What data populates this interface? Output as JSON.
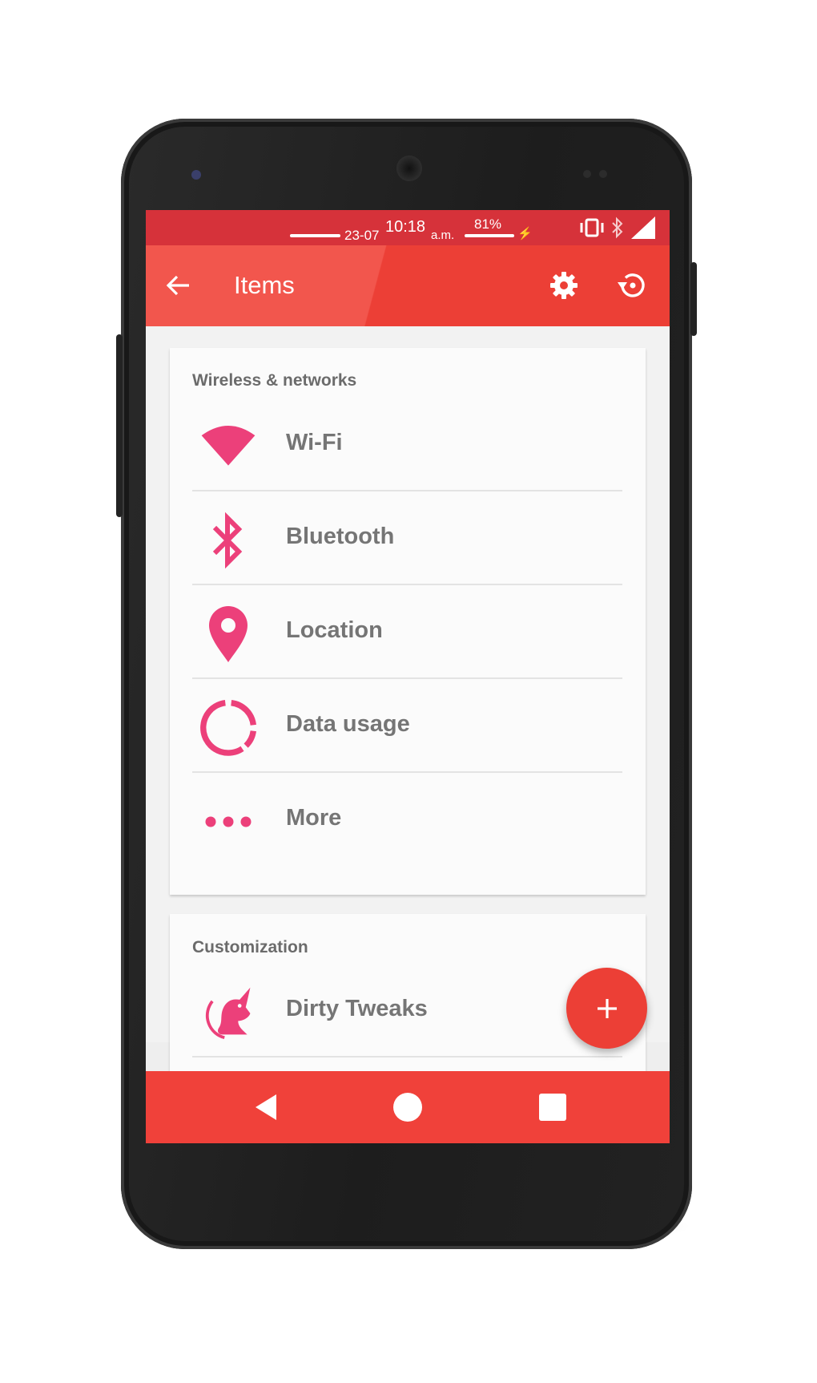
{
  "status_bar": {
    "date": "23-07",
    "time": "10:18",
    "ampm": "a.m.",
    "battery": "81%"
  },
  "app_bar": {
    "title": "Items",
    "back_icon": "arrow-back-icon",
    "settings_icon": "gear-icon",
    "restore_icon": "restore-icon"
  },
  "sections": [
    {
      "header": "Wireless & networks",
      "items": [
        {
          "label": "Wi-Fi",
          "icon": "wifi-icon"
        },
        {
          "label": "Bluetooth",
          "icon": "bluetooth-icon"
        },
        {
          "label": "Location",
          "icon": "location-pin-icon"
        },
        {
          "label": "Data usage",
          "icon": "data-usage-icon"
        },
        {
          "label": "More",
          "icon": "more-dots-icon"
        }
      ]
    },
    {
      "header": "Customization",
      "items": [
        {
          "label": "Dirty Tweaks",
          "icon": "unicorn-icon"
        }
      ]
    }
  ],
  "fab": {
    "icon": "plus-icon"
  },
  "colors": {
    "accent": "#ec3f36",
    "status_bar": "#d6323a",
    "icon_pink": "#ec407a",
    "nav_bar": "#f0413a"
  }
}
